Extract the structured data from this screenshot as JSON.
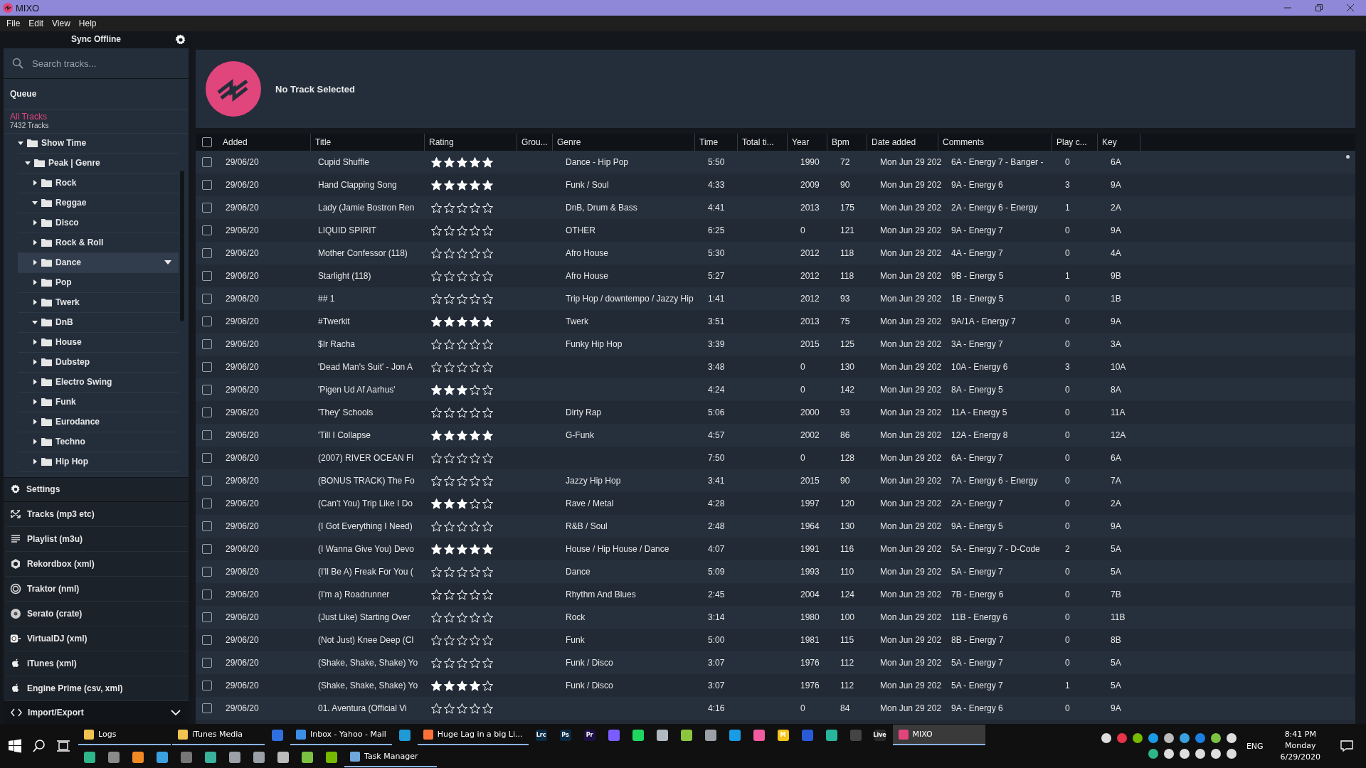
{
  "window": {
    "title": "MIXO"
  },
  "menu": [
    "File",
    "Edit",
    "View",
    "Help"
  ],
  "sidebar": {
    "sync_label": "Sync Offline",
    "search": {
      "placeholder": "Search tracks..."
    },
    "queue": "Queue",
    "all_tracks": {
      "label": "All Tracks",
      "count": "7432 Tracks",
      "selected": true
    },
    "tree": [
      {
        "label": "Show Time",
        "expanded": true,
        "hovered": false,
        "children": [
          {
            "label": "Peak | Genre",
            "expanded": true,
            "hovered": false,
            "children": [
              {
                "label": "Rock",
                "expanded": false,
                "hovered": false
              },
              {
                "label": "Reggae",
                "expanded": true,
                "hovered": false
              },
              {
                "label": "Disco",
                "expanded": false,
                "hovered": false
              },
              {
                "label": "Rock & Roll",
                "expanded": false,
                "hovered": false
              },
              {
                "label": "Dance",
                "expanded": false,
                "hovered": true
              },
              {
                "label": "Pop",
                "expanded": false,
                "hovered": false
              },
              {
                "label": "Twerk",
                "expanded": false,
                "hovered": false
              },
              {
                "label": "DnB",
                "expanded": true,
                "hovered": false
              },
              {
                "label": "House",
                "expanded": false,
                "hovered": false
              },
              {
                "label": "Dubstep",
                "expanded": false,
                "hovered": false
              },
              {
                "label": "Electro Swing",
                "expanded": false,
                "hovered": false
              },
              {
                "label": "Funk",
                "expanded": false,
                "hovered": false
              },
              {
                "label": "Eurodance",
                "expanded": false,
                "hovered": false
              },
              {
                "label": "Techno",
                "expanded": false,
                "hovered": false
              },
              {
                "label": "Hip Hop",
                "expanded": false,
                "hovered": false
              }
            ]
          }
        ]
      }
    ],
    "settings": "Settings",
    "formats": [
      {
        "kind": "tracks",
        "label": "Tracks (mp3 etc)"
      },
      {
        "kind": "playlist",
        "label": "Playlist (m3u)"
      },
      {
        "kind": "rekordbox",
        "label": "Rekordbox (xml)"
      },
      {
        "kind": "traktor",
        "label": "Traktor (nml)"
      },
      {
        "kind": "serato",
        "label": "Serato (crate)"
      },
      {
        "kind": "virtualdj",
        "label": "VirtualDJ (xml)"
      },
      {
        "kind": "apple",
        "label": "iTunes (xml)"
      },
      {
        "kind": "apple",
        "label": "Engine Prime (csv, xml)"
      }
    ],
    "import_export": {
      "label": "Import/Export",
      "expanded": true
    }
  },
  "player": {
    "track": "No Track Selected"
  },
  "table": {
    "select_all": false,
    "columns": [
      "Added",
      "Title",
      "Rating",
      "Grou...",
      "Genre",
      "Time",
      "Total ti...",
      "Year",
      "Bpm",
      "Date added",
      "Comments",
      "Play c...",
      "Key"
    ],
    "rows": [
      {
        "checked": false,
        "added": "29/06/20",
        "title": "Cupid Shuffle",
        "stars": 5,
        "genre": "Dance - Hip Pop",
        "time": "5:50",
        "year": "1990",
        "bpm": "72",
        "date_added": "Mon Jun 29 202",
        "comments": "6A - Energy 7 - Banger -",
        "plays": "0",
        "key": "6A"
      },
      {
        "checked": false,
        "added": "29/06/20",
        "title": "Hand Clapping Song",
        "stars": 5,
        "genre": "Funk / Soul",
        "time": "4:33",
        "year": "2009",
        "bpm": "90",
        "date_added": "Mon Jun 29 202",
        "comments": "9A - Energy 6",
        "plays": "3",
        "key": "9A"
      },
      {
        "checked": false,
        "added": "29/06/20",
        "title": "Lady (Jamie Bostron Ren",
        "stars": 0,
        "genre": "DnB, Drum & Bass",
        "time": "4:41",
        "year": "2013",
        "bpm": "175",
        "date_added": "Mon Jun 29 202",
        "comments": "2A - Energy 6 - Energy",
        "plays": "1",
        "key": "2A"
      },
      {
        "checked": false,
        "added": "29/06/20",
        "title": "LIQUID SPIRIT",
        "stars": 0,
        "genre": "OTHER",
        "time": "6:25",
        "year": "0",
        "bpm": "121",
        "date_added": "Mon Jun 29 202",
        "comments": "9A - Energy 7",
        "plays": "0",
        "key": "9A"
      },
      {
        "checked": false,
        "added": "29/06/20",
        "title": "Mother Confessor (118)",
        "stars": 0,
        "genre": "Afro House",
        "time": "5:30",
        "year": "2012",
        "bpm": "118",
        "date_added": "Mon Jun 29 202",
        "comments": "4A - Energy 7",
        "plays": "0",
        "key": "4A"
      },
      {
        "checked": false,
        "added": "29/06/20",
        "title": "Starlight (118)",
        "stars": 0,
        "genre": "Afro House",
        "time": "5:27",
        "year": "2012",
        "bpm": "118",
        "date_added": "Mon Jun 29 202",
        "comments": "9B - Energy 5",
        "plays": "1",
        "key": "9B"
      },
      {
        "checked": false,
        "added": "29/06/20",
        "title": "## 1",
        "stars": 0,
        "genre": "Trip Hop / downtempo / Jazzy Hip",
        "time": "1:41",
        "year": "2012",
        "bpm": "93",
        "date_added": "Mon Jun 29 202",
        "comments": "1B - Energy 5",
        "plays": "0",
        "key": "1B"
      },
      {
        "checked": false,
        "added": "29/06/20",
        "title": "#Twerkit",
        "stars": 5,
        "genre": "Twerk",
        "time": "3:51",
        "year": "2013",
        "bpm": "75",
        "date_added": "Mon Jun 29 202",
        "comments": "9A/1A - Energy 7",
        "plays": "0",
        "key": "9A"
      },
      {
        "checked": false,
        "added": "29/06/20",
        "title": "$Ir Racha",
        "stars": 0,
        "genre": "Funky Hip Hop",
        "time": "3:39",
        "year": "2015",
        "bpm": "125",
        "date_added": "Mon Jun 29 202",
        "comments": "3A - Energy 7",
        "plays": "0",
        "key": "3A"
      },
      {
        "checked": false,
        "added": "29/06/20",
        "title": "'Dead Man's Suit' - Jon A",
        "stars": 0,
        "time": "3:48",
        "year": "0",
        "bpm": "130",
        "date_added": "Mon Jun 29 202",
        "comments": "10A - Energy 6",
        "plays": "3",
        "key": "10A"
      },
      {
        "checked": false,
        "added": "29/06/20",
        "title": "'Pigen Ud Af Aarhus'",
        "stars": 3,
        "time": "4:24",
        "year": "0",
        "bpm": "142",
        "date_added": "Mon Jun 29 202",
        "comments": "8A - Energy 5",
        "plays": "0",
        "key": "8A"
      },
      {
        "checked": false,
        "added": "29/06/20",
        "title": "'They' Schools",
        "stars": 0,
        "genre": "Dirty Rap",
        "time": "5:06",
        "year": "2000",
        "bpm": "93",
        "date_added": "Mon Jun 29 202",
        "comments": "11A - Energy 5",
        "plays": "0",
        "key": "11A"
      },
      {
        "checked": false,
        "added": "29/06/20",
        "title": "'Till I Collapse",
        "stars": 5,
        "genre": "G-Funk",
        "time": "4:57",
        "year": "2002",
        "bpm": "86",
        "date_added": "Mon Jun 29 202",
        "comments": "12A - Energy 8",
        "plays": "0",
        "key": "12A"
      },
      {
        "checked": false,
        "added": "29/06/20",
        "title": "(2007) RIVER OCEAN Fl",
        "stars": 0,
        "time": "7:50",
        "year": "0",
        "bpm": "128",
        "date_added": "Mon Jun 29 202",
        "comments": "6A - Energy 7",
        "plays": "0",
        "key": "6A"
      },
      {
        "checked": false,
        "added": "29/06/20",
        "title": "(BONUS TRACK) The Fo",
        "stars": 0,
        "genre": "Jazzy Hip Hop",
        "time": "3:41",
        "year": "2015",
        "bpm": "90",
        "date_added": "Mon Jun 29 202",
        "comments": "7A - Energy 6 - Energy",
        "plays": "0",
        "key": "7A"
      },
      {
        "checked": false,
        "added": "29/06/20",
        "title": "(Can't You) Trip Like I Do",
        "stars": 3,
        "genre": "Rave / Metal",
        "time": "4:28",
        "year": "1997",
        "bpm": "120",
        "date_added": "Mon Jun 29 202",
        "comments": "2A - Energy 7",
        "plays": "0",
        "key": "2A"
      },
      {
        "checked": false,
        "added": "29/06/20",
        "title": "(I Got Everything I Need)",
        "stars": 0,
        "genre": "R&B / Soul",
        "time": "2:48",
        "year": "1964",
        "bpm": "130",
        "date_added": "Mon Jun 29 202",
        "comments": "9A - Energy 5",
        "plays": "0",
        "key": "9A"
      },
      {
        "checked": false,
        "added": "29/06/20",
        "title": "(I Wanna Give You) Devo",
        "stars": 5,
        "genre": "House / Hip House / Dance",
        "time": "4:07",
        "year": "1991",
        "bpm": "116",
        "date_added": "Mon Jun 29 202",
        "comments": "5A - Energy 7 - D-Code",
        "plays": "2",
        "key": "5A"
      },
      {
        "checked": false,
        "added": "29/06/20",
        "title": "(I'll Be A) Freak For You (",
        "stars": 0,
        "genre": "Dance",
        "time": "5:09",
        "year": "1993",
        "bpm": "110",
        "date_added": "Mon Jun 29 202",
        "comments": "5A - Energy 7",
        "plays": "0",
        "key": "5A"
      },
      {
        "checked": false,
        "added": "29/06/20",
        "title": "(I'm a) Roadrunner",
        "stars": 0,
        "genre": "Rhythm And Blues",
        "time": "2:45",
        "year": "2004",
        "bpm": "124",
        "date_added": "Mon Jun 29 202",
        "comments": "7B - Energy 6",
        "plays": "0",
        "key": "7B"
      },
      {
        "checked": false,
        "added": "29/06/20",
        "title": "(Just Like) Starting Over",
        "stars": 0,
        "genre": "Rock",
        "time": "3:14",
        "year": "1980",
        "bpm": "100",
        "date_added": "Mon Jun 29 202",
        "comments": "11B - Energy 6",
        "plays": "0",
        "key": "11B"
      },
      {
        "checked": false,
        "added": "29/06/20",
        "title": "(Not Just) Knee Deep (Cl",
        "stars": 0,
        "genre": "Funk",
        "time": "5:00",
        "year": "1981",
        "bpm": "115",
        "date_added": "Mon Jun 29 202",
        "comments": "8B - Energy 7",
        "plays": "0",
        "key": "8B"
      },
      {
        "checked": false,
        "added": "29/06/20",
        "title": "(Shake, Shake, Shake) Yo",
        "stars": 0,
        "genre": "Funk / Disco",
        "time": "3:07",
        "year": "1976",
        "bpm": "112",
        "date_added": "Mon Jun 29 202",
        "comments": "5A - Energy 7",
        "plays": "0",
        "key": "5A"
      },
      {
        "checked": false,
        "added": "29/06/20",
        "title": "(Shake, Shake, Shake) Yo",
        "stars": 4,
        "genre": "Funk / Disco",
        "time": "3:07",
        "year": "1976",
        "bpm": "112",
        "date_added": "Mon Jun 29 202",
        "comments": "5A - Energy 7",
        "plays": "1",
        "key": "5A"
      },
      {
        "checked": false,
        "added": "29/06/20",
        "title": "01. Aventura (Official Vi",
        "stars": 0,
        "time": "4:16",
        "year": "0",
        "bpm": "84",
        "date_added": "Mon Jun 29 202",
        "comments": "9A - Energy 6",
        "plays": "0",
        "key": "9A"
      }
    ]
  },
  "taskbar": {
    "row_1": [
      {
        "kind": "window",
        "label": "Logs",
        "color": "#f0c350",
        "selected": false
      },
      {
        "kind": "window",
        "label": "iTunes Media",
        "color": "#f0c350",
        "selected": false
      },
      {
        "kind": "icon",
        "color": "#2f6fe0",
        "selected": false
      },
      {
        "kind": "window",
        "label": "Inbox - Yahoo - Mail",
        "color": "#3a8ee6",
        "selected": false
      },
      {
        "kind": "icon",
        "color": "#1f9ad6",
        "selected": false
      },
      {
        "kind": "window",
        "label": "Huge Lag in a big Li...",
        "color": "#ff7139",
        "selected": false
      },
      {
        "kind": "icon",
        "label": "Lrc",
        "color": "#0b2a44",
        "selected": false
      },
      {
        "kind": "icon",
        "label": "Ps",
        "color": "#0b2a44",
        "selected": false
      },
      {
        "kind": "icon",
        "label": "Pr",
        "color": "#1e0f45",
        "selected": false
      },
      {
        "kind": "icon",
        "color": "#7b5cff",
        "selected": false
      },
      {
        "kind": "icon",
        "color": "#1ed760",
        "selected": false
      },
      {
        "kind": "icon",
        "color": "#b0b8c0",
        "selected": false
      },
      {
        "kind": "icon",
        "color": "#8cc63f",
        "selected": false
      },
      {
        "kind": "icon",
        "color": "#9aa0a6",
        "selected": false
      },
      {
        "kind": "icon",
        "color": "#1a9be6",
        "selected": false
      },
      {
        "kind": "icon",
        "color": "#f25ba0",
        "selected": false
      },
      {
        "kind": "icon",
        "label": "M",
        "color": "#f5c518",
        "selected": false
      },
      {
        "kind": "icon",
        "color": "#2a5bd7",
        "selected": false
      },
      {
        "kind": "icon",
        "color": "#27b59b",
        "selected": false
      },
      {
        "kind": "icon",
        "color": "#444444",
        "selected": false
      },
      {
        "kind": "icon",
        "label": "Live",
        "color": "#2a2a2a",
        "selected": false
      },
      {
        "kind": "window",
        "label": "MIXO",
        "color": "#e0457b",
        "selected": true
      }
    ],
    "row_2": [
      {
        "kind": "icon",
        "color": "#2fb58a",
        "selected": false
      },
      {
        "kind": "icon",
        "color": "#8a8a8a",
        "selected": false
      },
      {
        "kind": "icon",
        "color": "#f08a24",
        "selected": false
      },
      {
        "kind": "icon",
        "color": "#3aa0e0",
        "selected": false
      },
      {
        "kind": "icon",
        "color": "#777777",
        "selected": false
      },
      {
        "kind": "icon",
        "color": "#39b39b",
        "selected": false
      },
      {
        "kind": "icon",
        "color": "#9aa0a6",
        "selected": false
      },
      {
        "kind": "icon",
        "color": "#9aa0a6",
        "selected": false
      },
      {
        "kind": "icon",
        "color": "#bbbbbb",
        "selected": false
      },
      {
        "kind": "icon",
        "color": "#7cc242",
        "selected": false
      },
      {
        "kind": "icon",
        "color": "#76b900",
        "selected": false
      },
      {
        "kind": "window",
        "label": "Task Manager",
        "color": "#6fa8dc",
        "selected": false
      }
    ],
    "tray_1": [
      {
        "color": "#dddddd"
      },
      {
        "color": "#e8334a"
      },
      {
        "color": "#76b900"
      },
      {
        "color": "#1a9be6"
      },
      {
        "color": "#bbbbbb"
      },
      {
        "color": "#3aa0e0"
      },
      {
        "color": "#1a7fe0"
      },
      {
        "color": "#7cc242"
      },
      {
        "color": "#dddddd"
      }
    ],
    "tray_2": [
      {
        "color": "#2fb58a"
      },
      {
        "color": "#dddddd"
      },
      {
        "color": "#dddddd"
      },
      {
        "color": "#dddddd"
      },
      {
        "color": "#dddddd"
      },
      {
        "color": "#dddddd"
      }
    ],
    "language": "ENG",
    "clock": {
      "time": "8:41 PM",
      "day": "Monday",
      "date": "6/29/2020"
    }
  }
}
